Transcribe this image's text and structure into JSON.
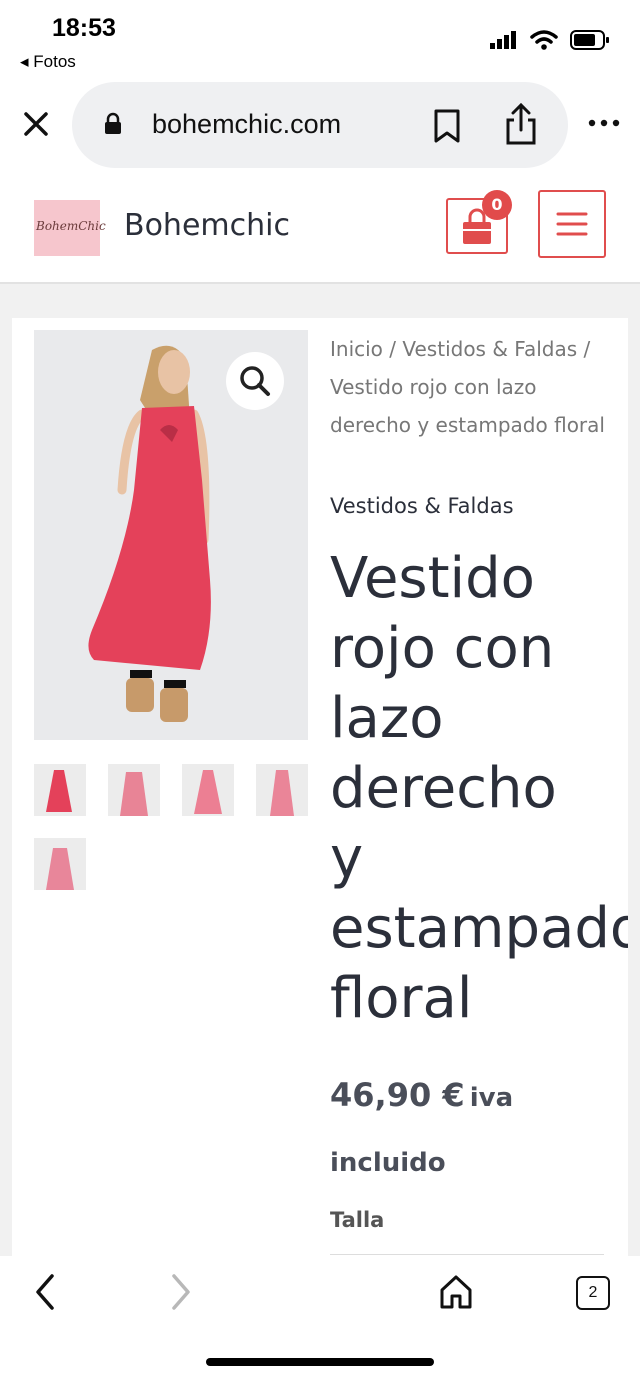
{
  "status": {
    "time": "18:53",
    "back_app": "◂ Fotos"
  },
  "browser": {
    "url": "bohemchic.com",
    "tab_count": "2"
  },
  "site": {
    "logo_text": "BohemChic",
    "name": "Bohemchic",
    "cart_count": "0"
  },
  "product": {
    "breadcrumb": "Inicio / Vestidos & Faldas / Vestido rojo con lazo derecho y estampado floral",
    "category": "Vestidos & Faldas",
    "title": "Vestido\nrojo con\nlazo\nderecho\ny\nestampado\nfloral",
    "price": "46,90 €",
    "price_suffix_1": "iva",
    "price_suffix_2": "incluido",
    "size_label": "Talla"
  },
  "colors": {
    "accent": "#e04d4d",
    "dress": "#e4415a",
    "text": "#2b2f3a"
  },
  "icons": [
    "close-icon",
    "lock-icon",
    "bookmark-icon",
    "share-icon",
    "more-icon",
    "cart-icon",
    "menu-icon",
    "zoom-icon",
    "chevron-left-icon",
    "chevron-right-icon",
    "home-icon"
  ]
}
